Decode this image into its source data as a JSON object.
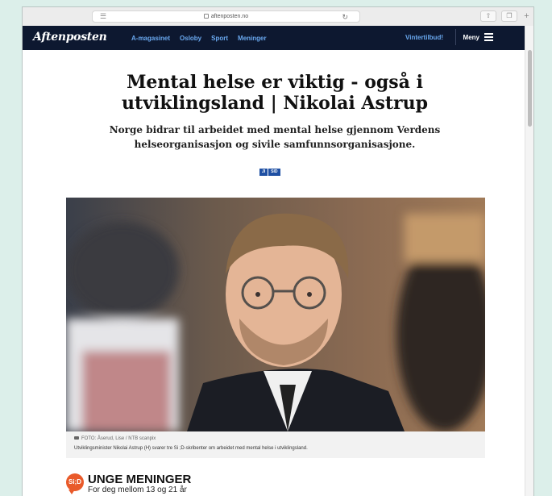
{
  "browser": {
    "url": "aftenposten.no"
  },
  "header": {
    "logo": "Aftenposten",
    "nav": [
      "A-magasinet",
      "Osloby",
      "Sport",
      "Meninger"
    ],
    "promo": "Vintertilbud!",
    "menu_label": "Meny"
  },
  "article": {
    "headline": "Mental helse er viktig - også i utviklingsland | Nikolai Astrup",
    "subheadline": "Norge bidrar til arbeidet med mental helse gjennom Verdens helseorganisasjon og sivile samfunnsorganisasjone.",
    "tags": [
      "JI",
      "SID"
    ],
    "photo_credit": "FOTO: Åserud, Lise / NTB scanpix",
    "photo_caption": "Utviklingsminister Nikolai Astrup (H) svarer tre Si ;D-skribenter om arbeidet med mental helse i utviklingsland."
  },
  "section_promo": {
    "logo_text": "Si;D",
    "title": "UNGE MENINGER",
    "subtitle": "For deg mellom 13 og 21 år"
  },
  "colors": {
    "header_bg": "#0d1830",
    "nav_link": "#6aa9f0",
    "tag_bg": "#1e4fa3",
    "sid_orange": "#e95a2a",
    "page_bg": "#dcefea"
  },
  "icons": [
    "reader-icon",
    "lock-icon",
    "reload-icon",
    "share-icon",
    "tabs-icon",
    "new-tab-icon",
    "hamburger-icon",
    "camera-icon"
  ]
}
